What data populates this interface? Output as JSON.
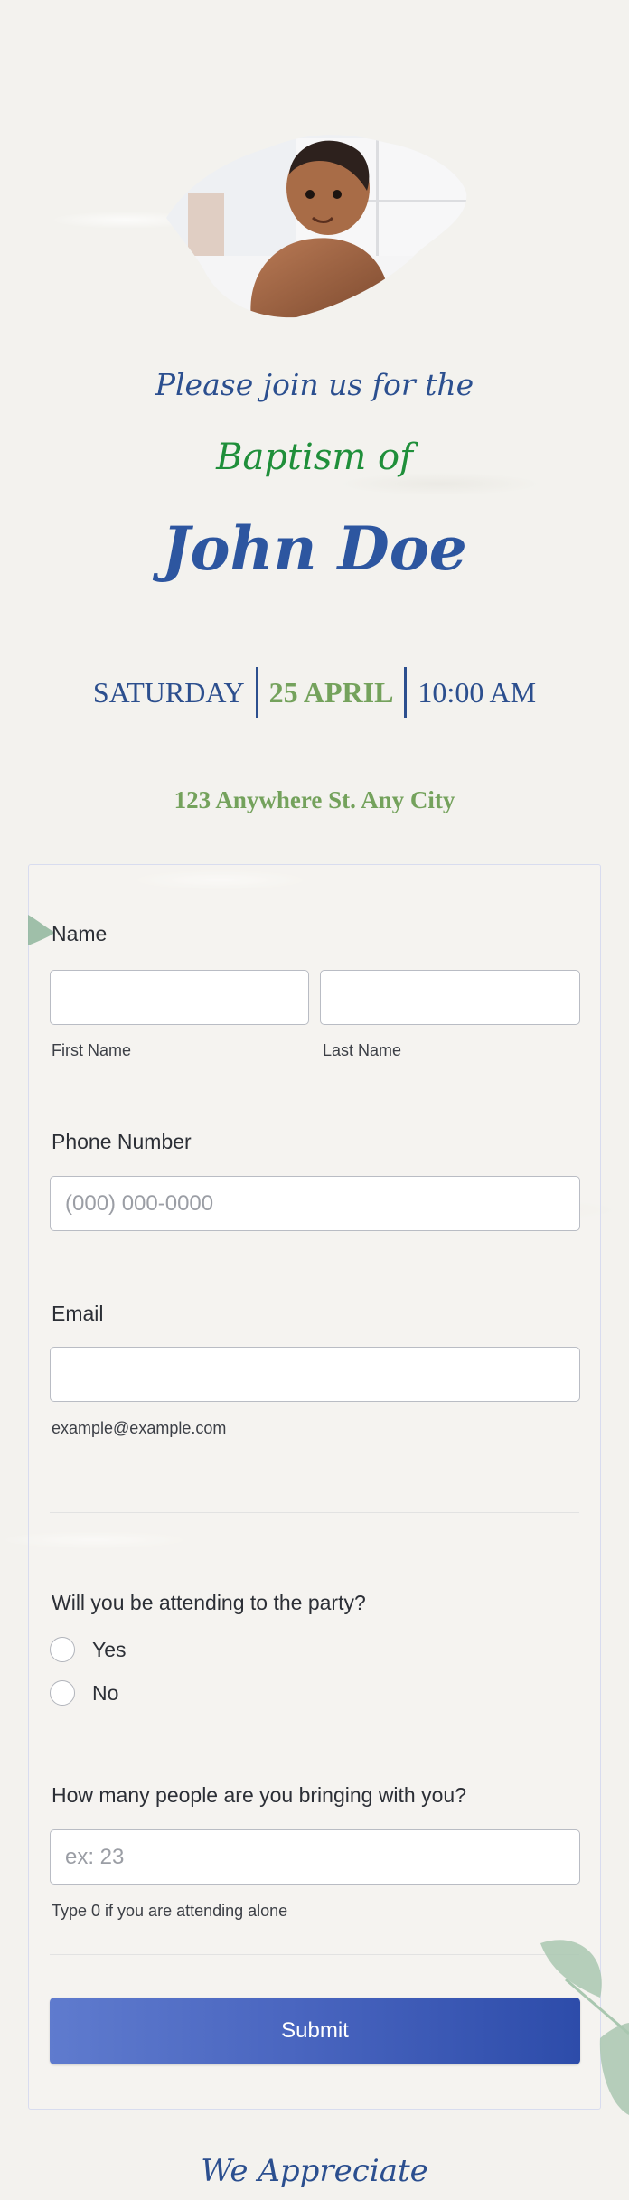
{
  "invitation": {
    "photo_alt": "baby-photo",
    "invite_line": "Please join us for the",
    "event_type": "Baptism of",
    "honoree_name": "John Doe",
    "day": "SATURDAY",
    "date": "25 APRIL",
    "time": "10:00 AM",
    "address": "123 Anywhere St. Any City",
    "closing": "We Appreciate"
  },
  "colors": {
    "primary_blue": "#2b4f8f",
    "accent_green": "#1f8f3a",
    "date_green": "#74a25c",
    "submit_gradient_start": "#5f7bce",
    "submit_gradient_end": "#2d4caa"
  },
  "form": {
    "name": {
      "label": "Name",
      "first": {
        "value": "",
        "sublabel": "First Name"
      },
      "last": {
        "value": "",
        "sublabel": "Last Name"
      }
    },
    "phone": {
      "label": "Phone Number",
      "value": "",
      "placeholder": "(000) 000-0000"
    },
    "email": {
      "label": "Email",
      "value": "",
      "sublabel": "example@example.com"
    },
    "attending": {
      "label": "Will you be attending to the party?",
      "options": [
        {
          "label": "Yes",
          "selected": false
        },
        {
          "label": "No",
          "selected": false
        }
      ]
    },
    "guests": {
      "label": "How many people are you bringing with you?",
      "value": "",
      "placeholder": "ex: 23",
      "sublabel": "Type 0 if you are attending alone"
    },
    "submit_label": "Submit"
  }
}
